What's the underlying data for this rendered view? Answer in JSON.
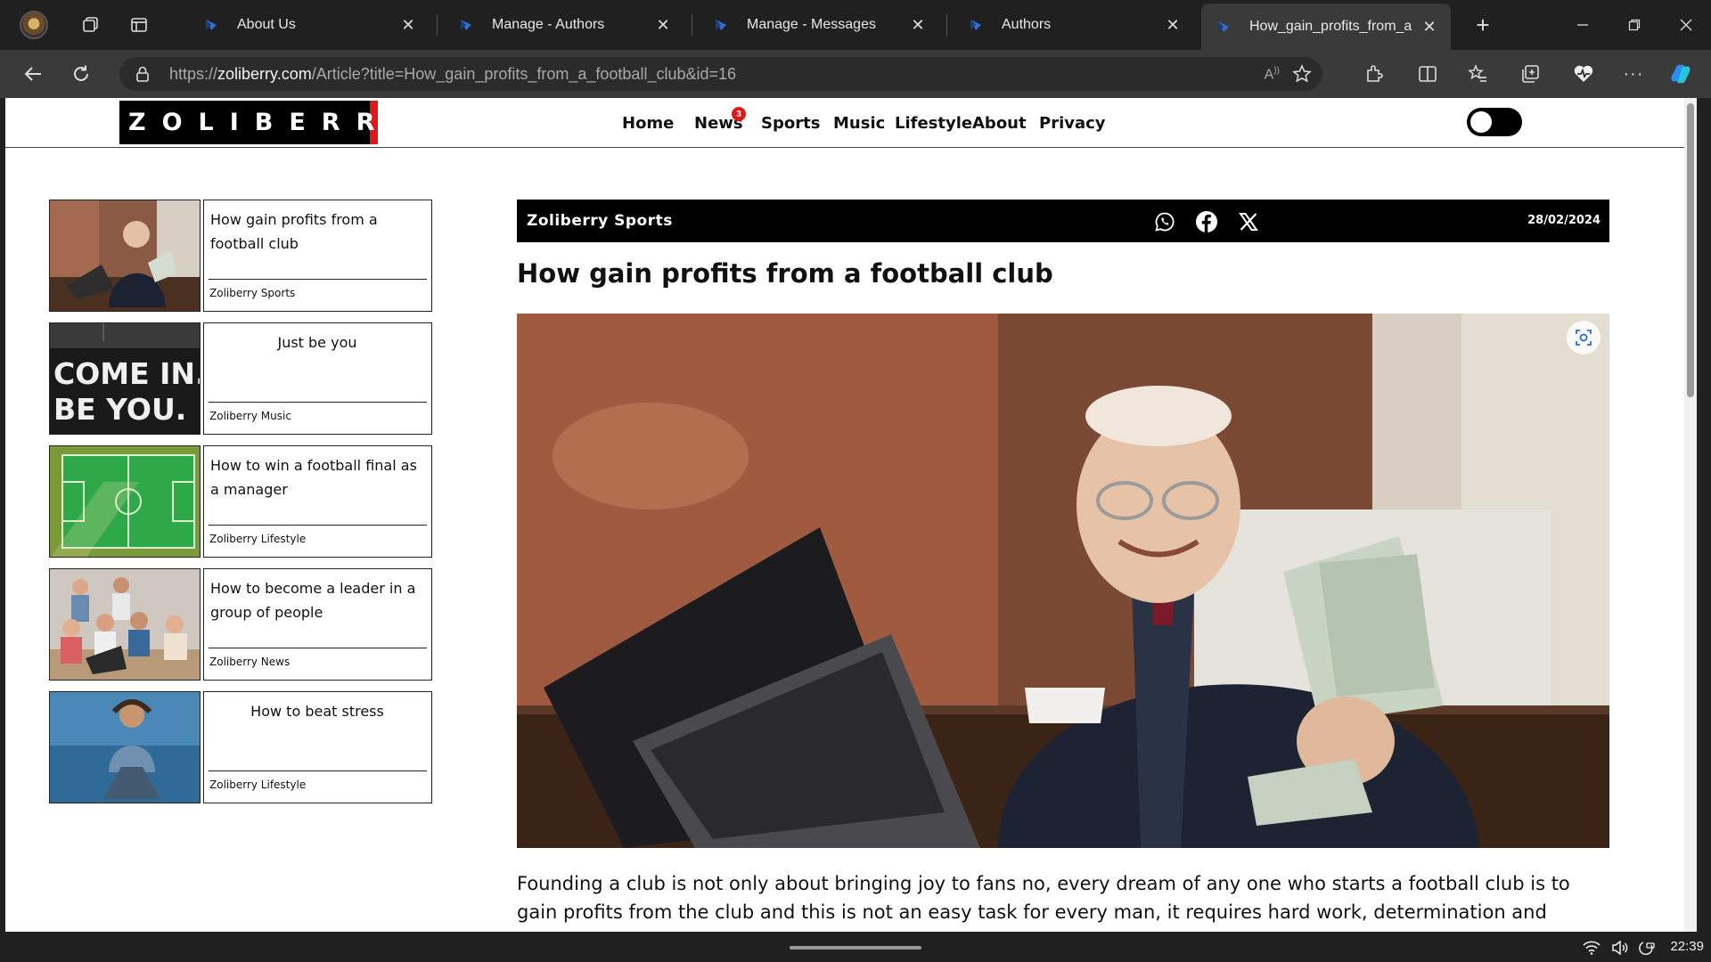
{
  "browser": {
    "tabs": [
      {
        "label": "About Us"
      },
      {
        "label": "Manage - Authors"
      },
      {
        "label": "Manage - Messages"
      },
      {
        "label": "Authors"
      },
      {
        "label": "How_gain_profits_from_a",
        "active": true
      }
    ],
    "url_prefix": "https://",
    "url_domain": "zoliberry.com",
    "url_path": "/Article?title=How_gain_profits_from_a_football_club&id=16"
  },
  "site": {
    "logo": "ZOLIBERRY",
    "nav": [
      {
        "label": "Home"
      },
      {
        "label": "News",
        "badge": "3"
      },
      {
        "label": "Sports"
      },
      {
        "label": "Music"
      },
      {
        "label": "Lifestyle"
      },
      {
        "label": "About"
      },
      {
        "label": "Privacy"
      }
    ],
    "theme_toggle": "off"
  },
  "sidebar": {
    "cards": [
      {
        "title": "How gain profits from a football club",
        "category": "Zoliberry Sports",
        "thumb": "old-man-with-money"
      },
      {
        "title": "Just be you",
        "category": "Zoliberry Music",
        "thumb": "come-in-be-you-sign"
      },
      {
        "title": "How to win a football final as a manager",
        "category": "Zoliberry Lifestyle",
        "thumb": "football-pitch"
      },
      {
        "title": "How to become a leader in a group of people",
        "category": "Zoliberry News",
        "thumb": "group-of-people"
      },
      {
        "title": "How to beat stress",
        "category": "Zoliberry Lifestyle",
        "thumb": "stressed-man"
      }
    ]
  },
  "article": {
    "category": "Zoliberry Sports",
    "date": "28/02/2024",
    "share_icons": [
      "whatsapp-icon",
      "facebook-icon",
      "x-icon"
    ],
    "title": "How gain profits from a football club",
    "body": "Founding a club is not only about bringing joy to fans no, every dream of any one who starts a football club is to gain profits from the club and this is not an easy task for every man, it requires hard work, determination and numerous"
  },
  "taskbar": {
    "time": "22:39"
  },
  "colors": {
    "accent_red": "#e01818",
    "chrome_dark": "#202020",
    "chrome_mid": "#3a3a3a"
  }
}
